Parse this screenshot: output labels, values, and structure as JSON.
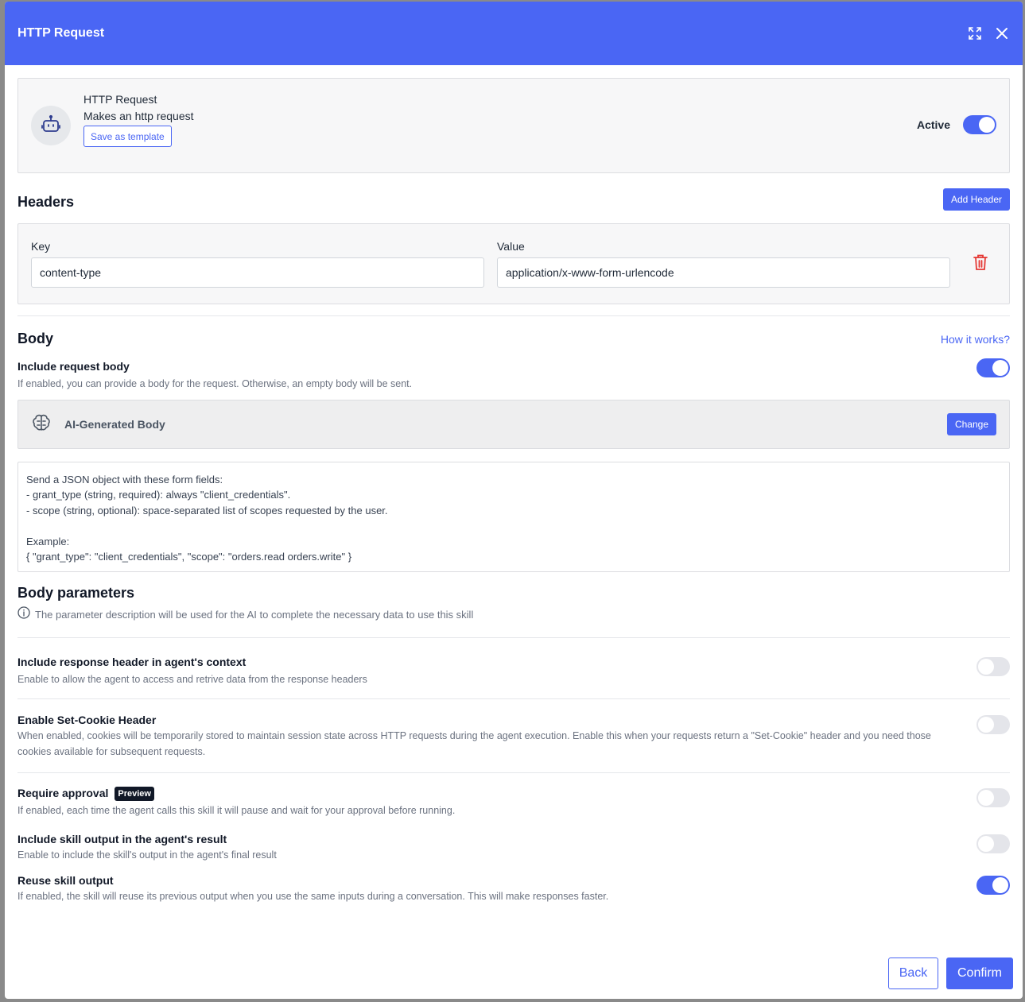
{
  "modal": {
    "title": "HTTP Request"
  },
  "skill": {
    "name": "HTTP Request",
    "description": "Makes an http request",
    "save_template_label": "Save as template",
    "active_label": "Active",
    "active": true
  },
  "headers": {
    "title": "Headers",
    "add_label": "Add Header",
    "key_label": "Key",
    "value_label": "Value",
    "rows": [
      {
        "key": "content-type",
        "value": "application/x-www-form-urlencode"
      }
    ]
  },
  "body": {
    "title": "Body",
    "how_it_works": "How it works?",
    "include_title": "Include request body",
    "include_desc": "If enabled, you can provide a body for the request. Otherwise, an empty body will be sent.",
    "include_enabled": true,
    "ai_label": "AI-Generated Body",
    "change_label": "Change",
    "prompt": "Send a JSON object with these form fields:\n- grant_type (string, required): always \"client_credentials\".\n- scope (string, optional): space-separated list of scopes requested by the user.\n\nExample:\n{ \"grant_type\": \"client_credentials\", \"scope\": \"orders.read orders.write\" }"
  },
  "body_params": {
    "title": "Body parameters",
    "info": "The parameter description will be used for the AI to complete the necessary data to use this skill"
  },
  "options": {
    "response_header": {
      "title": "Include response header in agent's context",
      "desc": "Enable to allow the agent to access and retrive data from the response headers",
      "enabled": false
    },
    "set_cookie": {
      "title": "Enable Set-Cookie Header",
      "desc": "When enabled, cookies will be temporarily stored to maintain session state across HTTP requests during the agent execution. Enable this when your requests return a \"Set-Cookie\" header and you need those cookies available for subsequent requests.",
      "enabled": false
    },
    "require_approval": {
      "title": "Require approval",
      "badge": "Preview",
      "desc": "If enabled, each time the agent calls this skill it will pause and wait for your approval before running.",
      "enabled": false
    },
    "skill_output": {
      "title": "Include skill output in the agent's result",
      "desc": "Enable to include the skill's output in the agent's final result",
      "enabled": false
    },
    "reuse_output": {
      "title": "Reuse skill output",
      "desc": "If enabled, the skill will reuse its previous output when you use the same inputs during a conversation. This will make responses faster.",
      "enabled": true
    }
  },
  "footer": {
    "back_label": "Back",
    "confirm_label": "Confirm"
  },
  "colors": {
    "accent": "#4a66f4",
    "danger": "#e53935"
  },
  "icons": [
    "expand-icon",
    "close-icon",
    "robot-icon",
    "trash-icon",
    "brain-icon",
    "info-icon"
  ]
}
